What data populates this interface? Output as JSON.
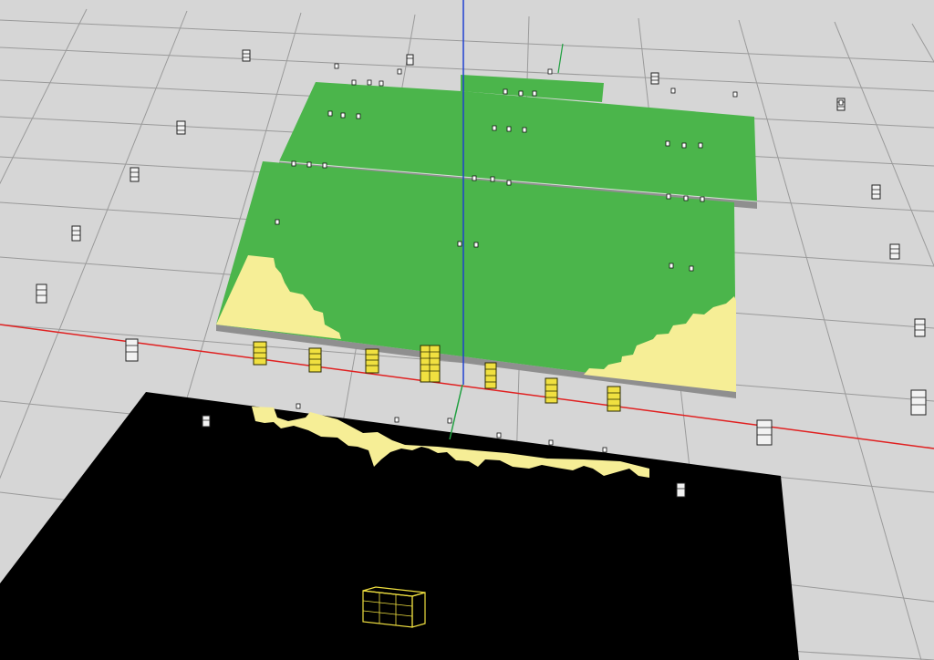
{
  "scene": {
    "background_color": "#d6d6d6",
    "grid_line_color": "#9a9a9a",
    "axes": {
      "x_axis_color": "#e02020",
      "y_axis_color": "#20a040",
      "z_axis_color": "#2040d0"
    },
    "panel_colors": {
      "covered_area": "#4bb54b",
      "uncovered_area": "#f6ee96",
      "panel_edge": "#8f8f8f",
      "bottom_panel": "#000000"
    },
    "speaker_colors": {
      "main_array_fill": "#f0e040",
      "main_array_outline": "#2a2a00",
      "aux_speaker_fill": "#f2f2f2",
      "aux_speaker_outline": "#222222"
    },
    "main_array_count": 7,
    "aux_speaker_count": 14
  }
}
